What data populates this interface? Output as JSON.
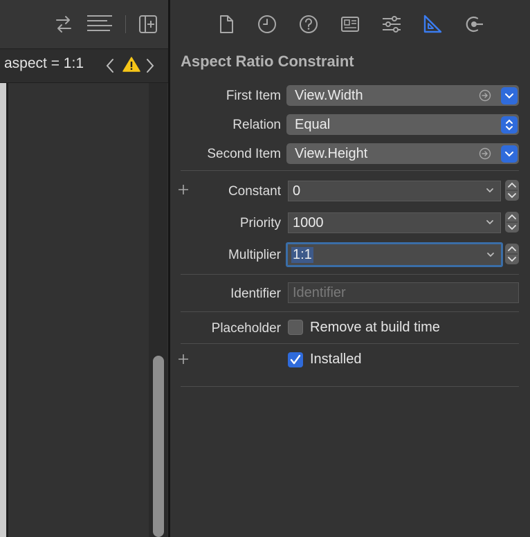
{
  "editor": {
    "jump_title": "aspect = 1:1"
  },
  "inspector": {
    "section_title": "Aspect Ratio Constraint",
    "first_item": {
      "label": "First Item",
      "value": "View.Width"
    },
    "relation": {
      "label": "Relation",
      "value": "Equal"
    },
    "second_item": {
      "label": "Second Item",
      "value": "View.Height"
    },
    "constant": {
      "label": "Constant",
      "value": "0"
    },
    "priority": {
      "label": "Priority",
      "value": "1000"
    },
    "multiplier": {
      "label": "Multiplier",
      "value": "1:1"
    },
    "identifier": {
      "label": "Identifier",
      "placeholder": "Identifier"
    },
    "placeholder": {
      "label": "Placeholder",
      "checkbox_label": "Remove at build time",
      "checked": false
    },
    "installed": {
      "checkbox_label": "Installed",
      "checked": true
    }
  },
  "colors": {
    "accent": "#2f6bdb",
    "warning": "#f5c518",
    "selected_tab": "#3b7cf0"
  },
  "icons": {
    "toolbar": [
      "swap-arrows-icon",
      "align-lines-icon",
      "add-panel-icon"
    ],
    "inspector_tabs": [
      "file-icon",
      "history-icon",
      "help-icon",
      "identity-icon",
      "attributes-icon",
      "size-ruler-icon",
      "connections-icon"
    ]
  }
}
